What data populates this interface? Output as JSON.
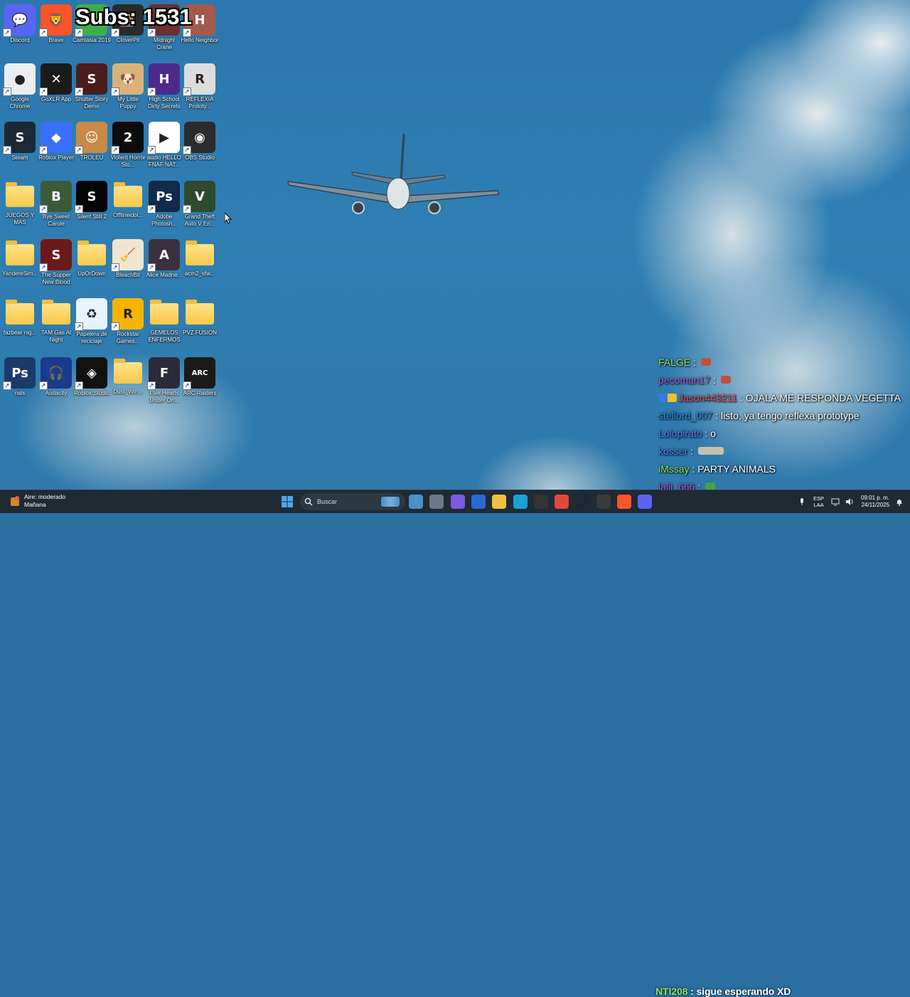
{
  "overlay": {
    "subs_counter": "Subs: 1531"
  },
  "desktop_icons": [
    {
      "label": "Discord",
      "color": "#5865F2",
      "glyph": "💬"
    },
    {
      "label": "Brave",
      "color": "#fb542b",
      "glyph": "🦁"
    },
    {
      "label": "Camtasia 2019",
      "color": "#3fae49",
      "glyph": "C"
    },
    {
      "label": "CloverPit",
      "color": "#2a2a2a",
      "glyph": "🎰"
    },
    {
      "label": "Midnight Crane",
      "color": "#6b2f2f",
      "glyph": "M"
    },
    {
      "label": "Hello Neighbor",
      "color": "#a35a4a",
      "glyph": "H"
    },
    {
      "label": "Google Chrome",
      "color": "#e9eef3",
      "glyph": "●"
    },
    {
      "label": "GoXLR App",
      "color": "#1b1b1b",
      "glyph": "✕"
    },
    {
      "label": "Shutter Story Demo",
      "color": "#4a1c1c",
      "glyph": "S"
    },
    {
      "label": "My Little Puppy",
      "color": "#d9b27a",
      "glyph": "🐶"
    },
    {
      "label": "High School Dirty Secrets",
      "color": "#4b2a8a",
      "glyph": "H"
    },
    {
      "label": "REFLEXIA Prototy...",
      "color": "#dddddd",
      "glyph": "R"
    },
    {
      "label": "Steam",
      "color": "#1b2838",
      "glyph": "S"
    },
    {
      "label": "Roblox Player",
      "color": "#3a6ff7",
      "glyph": "◆"
    },
    {
      "label": "TROLEU",
      "color": "#c98a45",
      "glyph": "☺"
    },
    {
      "label": "Violent Horror Sto...",
      "color": "#0c0c0c",
      "glyph": "2"
    },
    {
      "label": "audio HELLO FNAF NAT...",
      "color": "#ffffff",
      "glyph": "▶"
    },
    {
      "label": "OBS Studio",
      "color": "#2b2b2b",
      "glyph": "◉"
    },
    {
      "label": "JUEGOS Y MAS",
      "color": "folder",
      "glyph": ""
    },
    {
      "label": "Bye Sweet Carole",
      "color": "#3b5a3a",
      "glyph": "B"
    },
    {
      "label": "Silent Still 2",
      "color": "#050505",
      "glyph": "S"
    },
    {
      "label": "Offlineidol...",
      "color": "folder",
      "glyph": ""
    },
    {
      "label": "Adobe Photosh...",
      "color": "#0f2a4a",
      "glyph": "Ps"
    },
    {
      "label": "Grand Theft Auto V En...",
      "color": "#2d4a2d",
      "glyph": "V"
    },
    {
      "label": "YandereSim...",
      "color": "folder",
      "glyph": ""
    },
    {
      "label": "The Supper New Blood",
      "color": "#6b1a1a",
      "glyph": "S"
    },
    {
      "label": "UpOrDown",
      "color": "folder",
      "glyph": ""
    },
    {
      "label": "BleachBit",
      "color": "#f0e6d0",
      "glyph": "🧹"
    },
    {
      "label": "Alice Madne...",
      "color": "#3a3040",
      "glyph": "A"
    },
    {
      "label": "acm2_sfw...",
      "color": "folder",
      "glyph": ""
    },
    {
      "label": "fazbear nig...",
      "color": "folder",
      "glyph": ""
    },
    {
      "label": "TAM Gas At Night",
      "color": "folder",
      "glyph": ""
    },
    {
      "label": "Papelera de reciclaje",
      "color": "#e8f3fb",
      "glyph": "♻"
    },
    {
      "label": "Rockstar Games...",
      "color": "#f5b400",
      "glyph": "R"
    },
    {
      "label": "GEMELOS ENFERMOS",
      "color": "folder",
      "glyph": ""
    },
    {
      "label": "PVZ FUSION",
      "color": "folder",
      "glyph": ""
    },
    {
      "label": "nats",
      "color": "#1a3a6a",
      "glyph": "Ps"
    },
    {
      "label": "Audacity",
      "color": "#1a3a8a",
      "glyph": "🎧"
    },
    {
      "label": "Roblox Studio",
      "color": "#111111",
      "glyph": "◈"
    },
    {
      "label": "Dust_Win...",
      "color": "folder",
      "glyph": ""
    },
    {
      "label": "Five Hearts Under On...",
      "color": "#2a2a3a",
      "glyph": "F"
    },
    {
      "label": "ARC Raiders",
      "color": "#1a1a1a",
      "glyph": "ARC"
    }
  ],
  "chat": [
    {
      "user": "FALGE",
      "user_color": "#8fe05a",
      "message": "",
      "emote": "#c05040"
    },
    {
      "user": "pecoman17",
      "user_color": "#b05ad8",
      "message": "",
      "emote": "#c05040"
    },
    {
      "user": "Jason443211",
      "user_color": "#e0505a",
      "message": "OJALA ME RESPONDA VEGETTA",
      "emote": ""
    },
    {
      "user": "stellord_007",
      "user_color": "#2e8ee0",
      "message": "listo, ya tengo reflexa prototype",
      "emote": ""
    },
    {
      "user": "Lolopirato",
      "user_color": "#5a7ef0",
      "message": "o",
      "emote": ""
    },
    {
      "user": "kosser",
      "user_color": "#5a7ef0",
      "message": "",
      "emote": "#c8c0b0"
    },
    {
      "user": "iMssay",
      "user_color": "#8fe05a",
      "message": "PARTY ANIMALS",
      "emote": ""
    },
    {
      "user": "lalii_666",
      "user_color": "#b05ad8",
      "message": "",
      "emote": "#4aa040"
    }
  ],
  "taskbar": {
    "weather_line1": "Aire: moderado",
    "weather_line2": "Mañana",
    "search_placeholder": "Buscar",
    "apps": [
      "widgets",
      "file-explorer",
      "copilot",
      "store",
      "folder",
      "edge",
      "goxlr",
      "chrome",
      "steam",
      "obs",
      "brave",
      "discord"
    ],
    "bottom_chat_user": "NTI208",
    "bottom_chat_message": "sigue esperando XD",
    "lang_line1": "ESP",
    "lang_line2": "LAA",
    "time": "09:01 p. m.",
    "date": "24/11/2025"
  }
}
